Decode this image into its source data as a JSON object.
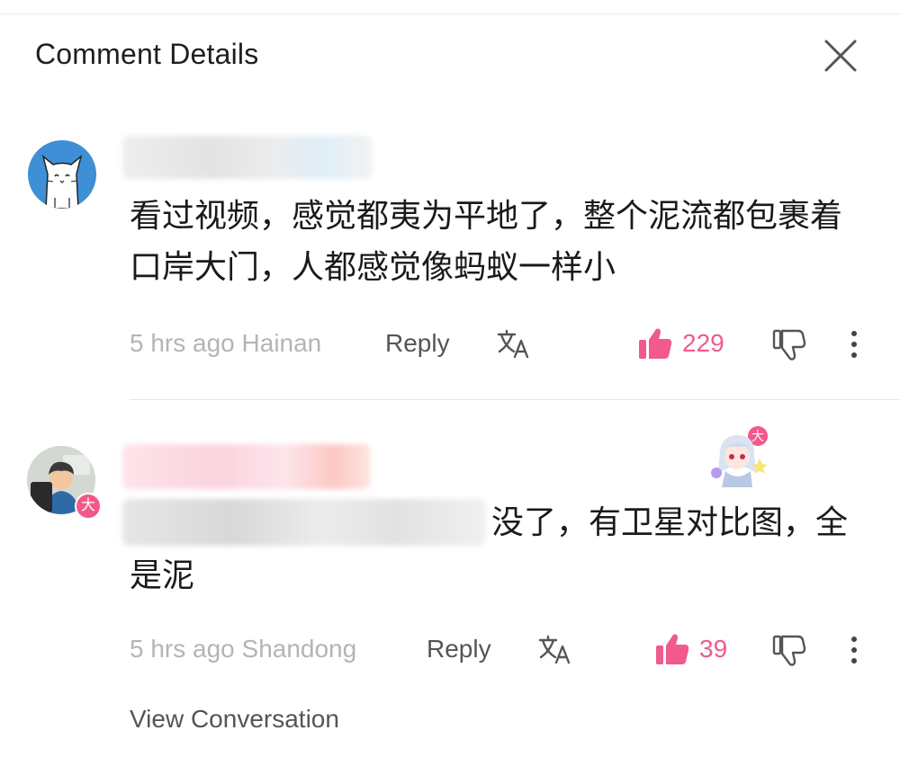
{
  "header": {
    "title": "Comment Details",
    "close_icon": "close-icon"
  },
  "comments": [
    {
      "text": "看过视频，感觉都夷为平地了，整个泥流都包裹着口岸大门，人都感觉像蚂蚁一样小",
      "meta": "5 hrs ago Hainan",
      "reply_label": "Reply",
      "likes": "229"
    },
    {
      "text_visible_part1": "没了，有卫星对比图，全",
      "text_visible_part2": "是泥",
      "badge": "大",
      "meta": "5 hrs ago Shandong",
      "reply_label": "Reply",
      "likes": "39"
    }
  ],
  "footer": {
    "view_conversation_label": "View Conversation"
  },
  "colors": {
    "accent_pink": "#f05a8e",
    "avatar_blue": "#3f8fd6",
    "muted": "#b4b4b4"
  }
}
